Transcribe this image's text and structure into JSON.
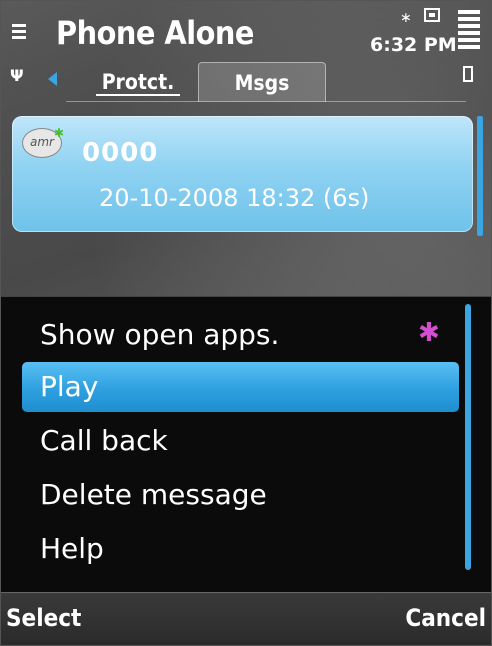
{
  "status": {
    "app_title": "Phone Alone",
    "time": "6:32 PM",
    "bluetooth_glyph": "∗"
  },
  "tabs": [
    {
      "label": "Protct."
    },
    {
      "label": "Msgs",
      "selected": true
    }
  ],
  "message": {
    "icon_label": "amr",
    "sender": "0000",
    "datetime": "20-10-2008 18:32 (6s)"
  },
  "menu": {
    "items": [
      {
        "label": "Show open apps."
      },
      {
        "label": "Play",
        "highlighted": true
      },
      {
        "label": "Call back"
      },
      {
        "label": "Delete message"
      },
      {
        "label": "Help"
      }
    ]
  },
  "softkeys": {
    "left": "Select",
    "right": "Cancel"
  },
  "colors": {
    "accent": "#2ea0e0",
    "card": "#8fd2f2",
    "menu_bg": "#0b0b0b"
  }
}
